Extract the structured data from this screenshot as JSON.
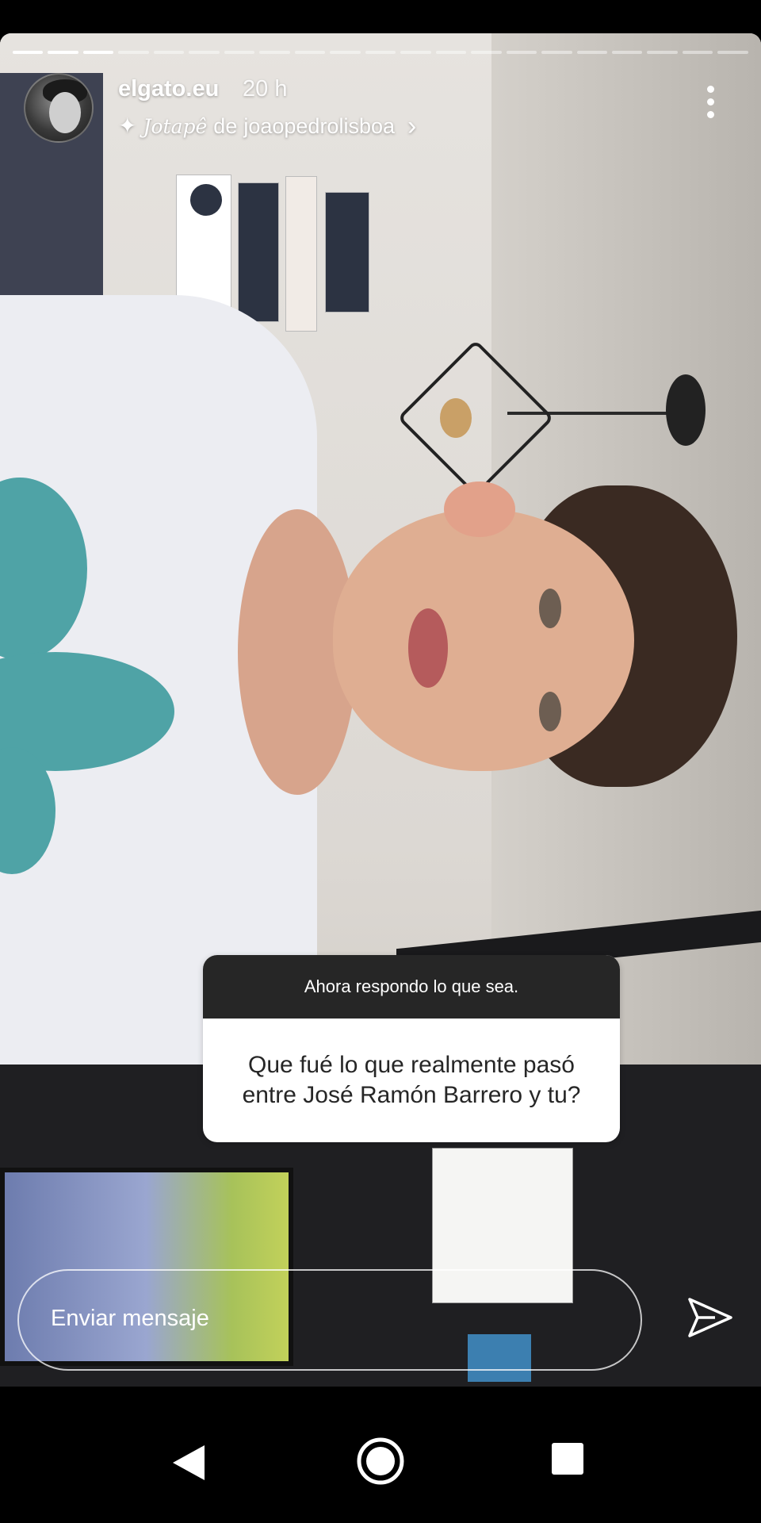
{
  "story": {
    "progress": {
      "segments_total": 21,
      "segments_done": 3
    },
    "header": {
      "username": "elgato.eu",
      "time": "20 h",
      "audio": {
        "name": "Jotapê",
        "connector": "de",
        "artist": "joaopedrolisboa"
      }
    },
    "question_sticker": {
      "prompt": "Ahora respondo lo que sea.",
      "question": "Que fué lo que realmente pasó entre José Ramón Barrero y tu?"
    },
    "reply": {
      "placeholder": "Enviar mensaje"
    }
  },
  "icons": {
    "audio": "sparkle-icon",
    "more": "more-vertical-icon",
    "chevron": "chevron-right-icon",
    "send": "send-icon",
    "nav_back": "nav-back-icon",
    "nav_home": "nav-home-icon",
    "nav_recent": "nav-recent-icon"
  },
  "colors": {
    "sticker_header": "#262626",
    "sticker_body": "#ffffff",
    "background": "#000000"
  }
}
